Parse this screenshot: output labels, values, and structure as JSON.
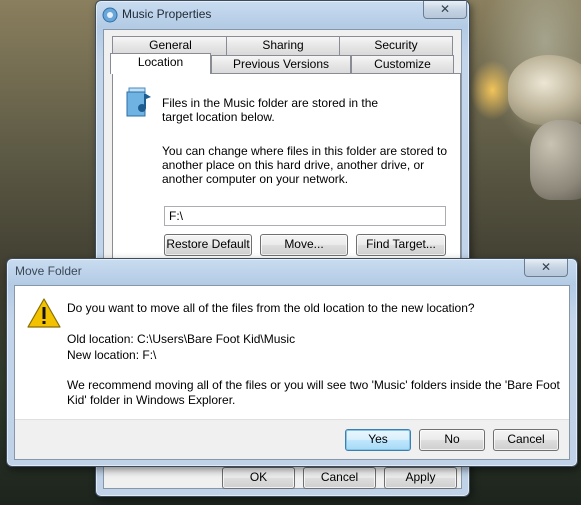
{
  "properties_window": {
    "title": "Music Properties",
    "close": "✕",
    "tabs_row1": [
      "General",
      "Sharing",
      "Security"
    ],
    "tabs_row2": [
      "Location",
      "Previous Versions",
      "Customize"
    ],
    "active_tab": "Location",
    "description1": "Files in the Music folder are stored in the target location below.",
    "description2": "You can change where files in this folder are stored to another place on this hard drive, another drive, or another computer on your network.",
    "path_value": "F:\\",
    "buttons": {
      "restore": "Restore Default",
      "move": "Move...",
      "find": "Find Target..."
    },
    "footer": {
      "ok": "OK",
      "cancel": "Cancel",
      "apply": "Apply"
    }
  },
  "move_dialog": {
    "title": "Move Folder",
    "close": "✕",
    "question": "Do you want to move all of the files from the old location to the new location?",
    "old_location": "Old location: C:\\Users\\Bare Foot Kid\\Music",
    "new_location": "New location: F:\\",
    "recommendation": "We recommend moving all of the files or you will see two 'Music' folders inside the 'Bare Foot Kid' folder in Windows Explorer.",
    "buttons": {
      "yes": "Yes",
      "no": "No",
      "cancel": "Cancel"
    },
    "icon": "warning-icon"
  },
  "colors": {
    "accent": "#3c7fb1",
    "warning": "#f2c200"
  }
}
